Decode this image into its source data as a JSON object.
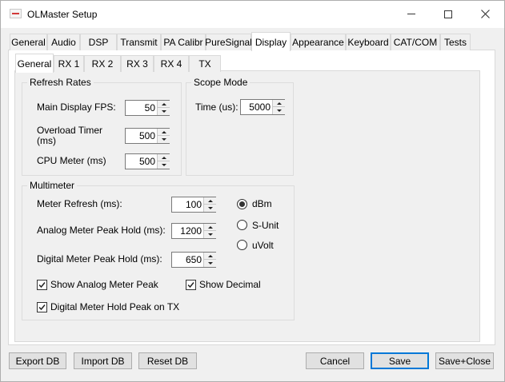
{
  "window": {
    "title": "OLMaster Setup"
  },
  "tabs": {
    "top": [
      "General",
      "Audio",
      "DSP",
      "Transmit",
      "PA Calibr",
      "PureSignal",
      "Display",
      "Appearance",
      "Keyboard",
      "CAT/COM",
      "Tests"
    ],
    "top_active": "Display",
    "inner": [
      "General",
      "RX 1",
      "RX 2",
      "RX 3",
      "RX 4",
      "TX"
    ],
    "inner_active": "General"
  },
  "refresh_rates": {
    "title": "Refresh Rates",
    "main_fps_label": "Main Display FPS:",
    "main_fps_value": "50",
    "overload_label_1": "Overload Timer",
    "overload_label_2": "(ms)",
    "overload_value": "500",
    "cpu_label": "CPU Meter (ms)",
    "cpu_value": "500"
  },
  "scope_mode": {
    "title": "Scope Mode",
    "time_label": "Time (us):",
    "time_value": "5000"
  },
  "multimeter": {
    "title": "Multimeter",
    "meter_refresh_label": "Meter Refresh (ms):",
    "meter_refresh_value": "100",
    "analog_peak_label": "Analog Meter Peak Hold (ms):",
    "analog_peak_value": "1200",
    "digital_peak_label": "Digital Meter Peak Hold (ms):",
    "digital_peak_value": "650",
    "units": [
      "dBm",
      "S-Unit",
      "uVolt"
    ],
    "unit_selected": "dBm",
    "show_analog_peak_label": "Show Analog Meter Peak",
    "show_analog_peak_checked": true,
    "show_decimal_label": "Show Decimal",
    "show_decimal_checked": true,
    "digital_hold_tx_label": "Digital Meter Hold Peak on TX",
    "digital_hold_tx_checked": true
  },
  "buttons": {
    "export_db": "Export DB",
    "import_db": "Import DB",
    "reset_db": "Reset DB",
    "cancel": "Cancel",
    "save": "Save",
    "save_close": "Save+Close"
  }
}
